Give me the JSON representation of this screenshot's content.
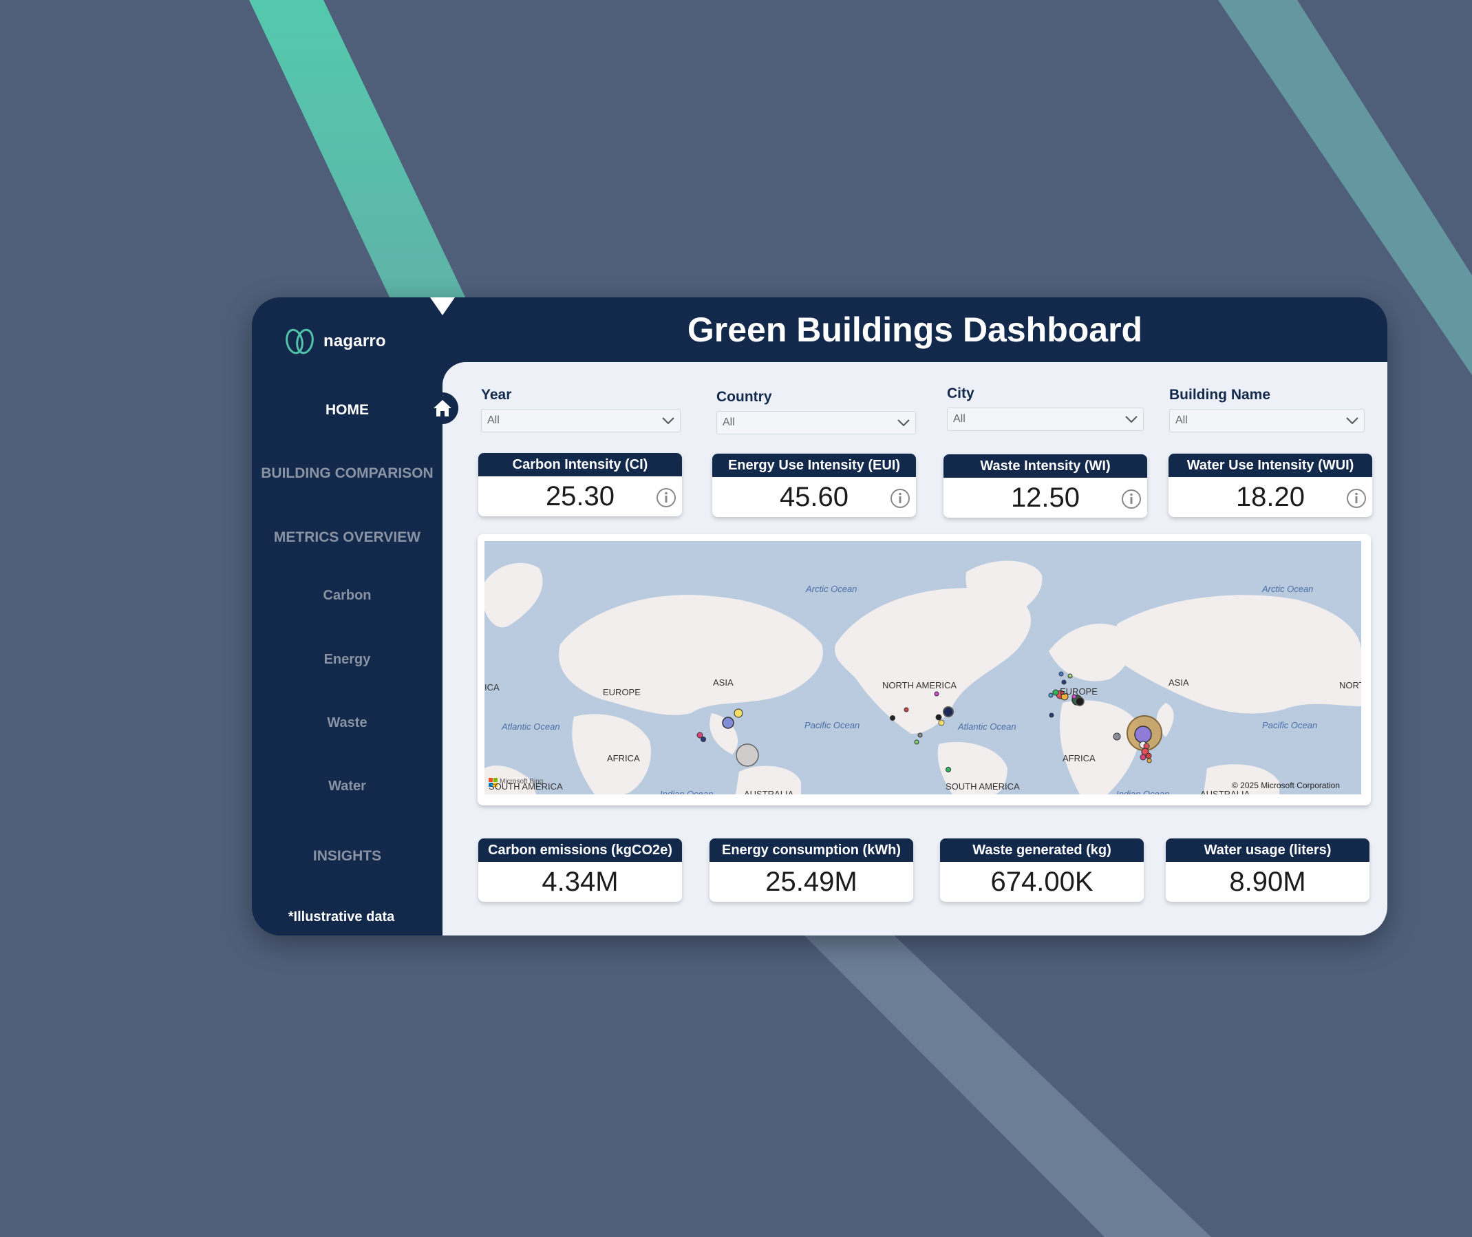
{
  "app": {
    "logo_text": "nagarro",
    "title": "Green Buildings Dashboard",
    "note": "*Illustrative data"
  },
  "sidebar": {
    "home": "HOME",
    "building_comparison": "BUILDING COMPARISON",
    "metrics_overview": "METRICS OVERVIEW",
    "carbon": "Carbon",
    "energy": "Energy",
    "waste": "Waste",
    "water": "Water",
    "insights": "INSIGHTS"
  },
  "filters": {
    "year": {
      "label": "Year",
      "value": "All"
    },
    "country": {
      "label": "Country",
      "value": "All"
    },
    "city": {
      "label": "City",
      "value": "All"
    },
    "building": {
      "label": "Building Name",
      "value": "All"
    }
  },
  "kpis_top": [
    {
      "label": "Carbon Intensity (CI)",
      "value": "25.30"
    },
    {
      "label": "Energy Use Intensity (EUI)",
      "value": "45.60"
    },
    {
      "label": "Waste Intensity (WI)",
      "value": "12.50"
    },
    {
      "label": "Water Use Intensity (WUI)",
      "value": "18.20"
    }
  ],
  "kpis_bottom": [
    {
      "label": "Carbon emissions (kgCO2e)",
      "value": "4.34M"
    },
    {
      "label": "Energy consumption (kWh)",
      "value": "25.49M"
    },
    {
      "label": "Waste generated (kg)",
      "value": "674.00K"
    },
    {
      "label": "Water usage (liters)",
      "value": "8.90M"
    }
  ],
  "map": {
    "continents": {
      "ica_left": "ICA",
      "europe_left": "EUROPE",
      "asia_left": "ASIA",
      "africa_left": "AFRICA",
      "south_america_left": "SOUTH AMERICA",
      "australia_left": "AUSTRALIA",
      "north_america": "NORTH AMERICA",
      "europe_right": "EUROPE",
      "asia_right": "ASIA",
      "nort_right": "NORT",
      "africa_right": "AFRICA",
      "south_america_right": "SOUTH AMERICA",
      "australia_right": "AUSTRALIA"
    },
    "oceans": {
      "arctic_left": "Arctic Ocean",
      "arctic_right": "Arctic Ocean",
      "atlantic_left": "Atlantic Ocean",
      "pacific_left": "Pacific Ocean",
      "atlantic_right": "Atlantic Ocean",
      "pacific_right": "Pacific Ocean",
      "indian_left": "Indian Ocean",
      "indian_right": "Indian Ocean"
    },
    "bing_attribution": "Microsoft Bing",
    "copyright": "© 2025 Microsoft Corporation"
  },
  "colors": {
    "navy": "#13294b",
    "teal": "#52c4ab",
    "page_background": "#4f5f7a",
    "content_background": "#edf1f7"
  }
}
